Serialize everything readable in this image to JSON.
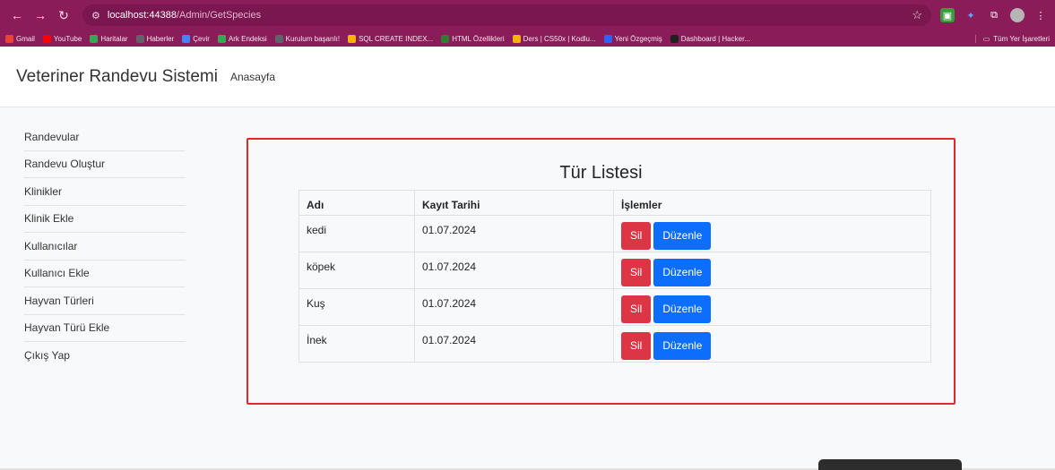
{
  "browser": {
    "url_host": "localhost:44388",
    "url_path": "/Admin/GetSpecies",
    "bookmarks": [
      {
        "label": "Gmail",
        "color": "#ea4335"
      },
      {
        "label": "YouTube",
        "color": "#ff0000"
      },
      {
        "label": "Haritalar",
        "color": "#34a853"
      },
      {
        "label": "Haberler",
        "color": "#5f6368"
      },
      {
        "label": "Çevir",
        "color": "#4285f4"
      },
      {
        "label": "Ark Endeksi",
        "color": "#34a853"
      },
      {
        "label": "Kurulum başarılı!",
        "color": "#5f6368"
      },
      {
        "label": "SQL CREATE INDEX...",
        "color": "#f4b400"
      },
      {
        "label": "HTML Özellikleri",
        "color": "#2e7d32"
      },
      {
        "label": "Ders | CS50x | Kodlu...",
        "color": "#f4b400"
      },
      {
        "label": "Yeni Özgeçmiş",
        "color": "#2962ff"
      },
      {
        "label": "Dashboard | Hacker...",
        "color": "#212121"
      }
    ],
    "all_bookmarks": "Tüm Yer İşaretleri"
  },
  "app": {
    "brand": "Veteriner Randevu Sistemi",
    "home_link": "Anasayfa"
  },
  "sidebar": {
    "items": [
      "Randevular",
      "Randevu Oluştur",
      "Klinikler",
      "Klinik Ekle",
      "Kullanıcılar",
      "Kullanıcı Ekle",
      "Hayvan Türleri",
      "Hayvan Türü Ekle",
      "Çıkış Yap"
    ]
  },
  "main": {
    "title": "Tür Listesi",
    "columns": [
      "Adı",
      "Kayıt Tarihi",
      "İşlemler"
    ],
    "rows": [
      {
        "name": "kedi",
        "date": "01.07.2024"
      },
      {
        "name": "köpek",
        "date": "01.07.2024"
      },
      {
        "name": "Kuş",
        "date": "01.07.2024"
      },
      {
        "name": "İnek",
        "date": "01.07.2024"
      }
    ],
    "delete_label": "Sil",
    "edit_label": "Düzenle"
  },
  "colors": {
    "delete": "#dc3545",
    "edit": "#0d6efd",
    "highlight_border": "#e02a2a",
    "browser_chrome": "#8a1c5a"
  }
}
